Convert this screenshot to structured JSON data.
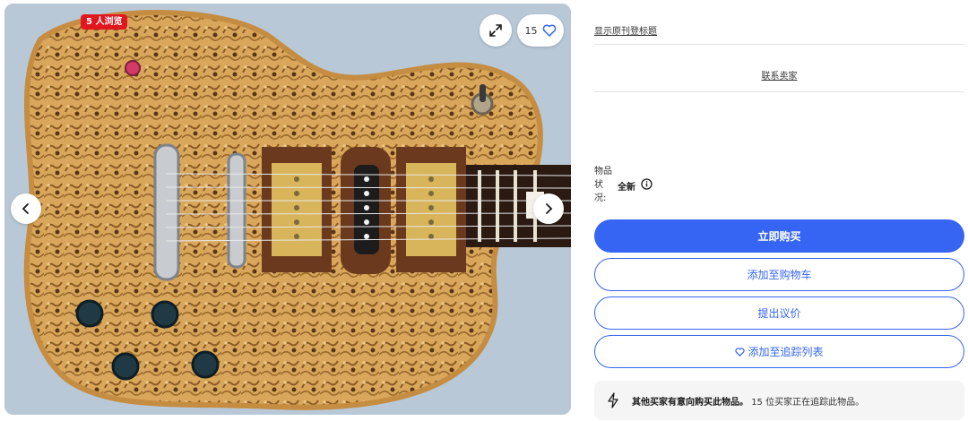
{
  "gallery": {
    "viewer_badge": "5 人浏览",
    "watch_count": "15"
  },
  "panel": {
    "original_title_link": "显示原刊登标题",
    "contact_seller_link": "联系卖家",
    "condition_label": "物品状况:",
    "condition_value": "全新",
    "buy_now": "立即购买",
    "add_to_cart": "添加至购物车",
    "make_offer": "提出议价",
    "add_to_watchlist": "添加至追踪列表",
    "interest_bold": "其他买家有意向购买此物品。",
    "interest_rest": "15 位买家正在追踪此物品。"
  },
  "colors": {
    "accent": "#3665f3",
    "badge": "#e0171f"
  }
}
